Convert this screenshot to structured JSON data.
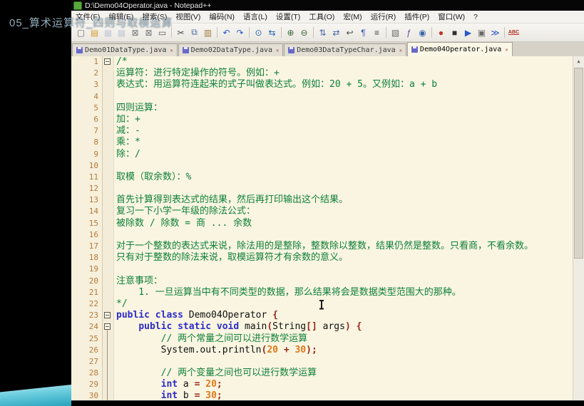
{
  "overlay": {
    "video_title": "05_算术运算符_四则与取模运算"
  },
  "window": {
    "title": "D:\\Demo04Operator.java - Notepad++"
  },
  "menu": {
    "items": [
      {
        "name": "file",
        "label": "文件(F)"
      },
      {
        "name": "edit",
        "label": "编辑(E)"
      },
      {
        "name": "search",
        "label": "搜索(S)"
      },
      {
        "name": "view",
        "label": "视图(V)"
      },
      {
        "name": "encoding",
        "label": "编码(N)"
      },
      {
        "name": "language",
        "label": "语言(L)"
      },
      {
        "name": "settings",
        "label": "设置(T)"
      },
      {
        "name": "tools",
        "label": "工具(O)"
      },
      {
        "name": "macro",
        "label": "宏(M)"
      },
      {
        "name": "run",
        "label": "运行(R)"
      },
      {
        "name": "plugins",
        "label": "插件(P)"
      },
      {
        "name": "window",
        "label": "窗口(W)"
      },
      {
        "name": "help",
        "label": "?"
      }
    ]
  },
  "toolbar": {
    "items": [
      {
        "name": "new-file",
        "glyph": "▢",
        "color": "#6a6a6a"
      },
      {
        "name": "open-file",
        "glyph": "▤",
        "color": "#d79b2a"
      },
      {
        "name": "save",
        "glyph": "▦",
        "color": "#8090b8",
        "disabled": true
      },
      {
        "name": "save-all",
        "glyph": "▩",
        "color": "#8090b8",
        "disabled": true
      },
      {
        "name": "close",
        "glyph": "⊠",
        "color": "#7a7a7a"
      },
      {
        "name": "close-all",
        "glyph": "⊠",
        "color": "#7a7a7a"
      },
      {
        "name": "print",
        "glyph": "▭",
        "color": "#5a5a5a"
      },
      {
        "sep": true
      },
      {
        "name": "cut",
        "glyph": "✂",
        "color": "#4a4a4a"
      },
      {
        "name": "copy",
        "glyph": "⧉",
        "color": "#4a6aaa"
      },
      {
        "name": "paste",
        "glyph": "▥",
        "color": "#a07840"
      },
      {
        "sep": true
      },
      {
        "name": "undo",
        "glyph": "↶",
        "color": "#2858c8"
      },
      {
        "name": "redo",
        "glyph": "↷",
        "color": "#2858c8"
      },
      {
        "sep": true
      },
      {
        "name": "find",
        "glyph": "⊙",
        "color": "#2868b0"
      },
      {
        "name": "replace",
        "glyph": "⇆",
        "color": "#2868b0"
      },
      {
        "sep": true
      },
      {
        "name": "zoom-in",
        "glyph": "⊕",
        "color": "#386838"
      },
      {
        "name": "zoom-out",
        "glyph": "⊖",
        "color": "#386838"
      },
      {
        "sep": true
      },
      {
        "name": "sync-vertical-scroll",
        "glyph": "⇅",
        "color": "#4a6aaa"
      },
      {
        "name": "sync-horizontal-scroll",
        "glyph": "⇄",
        "color": "#4a6aaa"
      },
      {
        "name": "word-wrap",
        "glyph": "↩",
        "color": "#4a4a4a"
      },
      {
        "name": "show-all-characters",
        "glyph": "¶",
        "color": "#3858b8"
      },
      {
        "name": "indent-guide",
        "glyph": "≡",
        "color": "#4a4a4a"
      },
      {
        "sep": true
      },
      {
        "name": "document-map",
        "glyph": "▧",
        "color": "#6a6a6a"
      },
      {
        "name": "function-list",
        "glyph": "ƒ",
        "color": "#6a4a9a"
      },
      {
        "name": "monitoring",
        "glyph": "◉",
        "color": "#3868a8"
      },
      {
        "sep": true
      },
      {
        "name": "record-macro",
        "glyph": "●",
        "color": "#c03028"
      },
      {
        "name": "stop-macro",
        "glyph": "■",
        "color": "#303030"
      },
      {
        "name": "play-macro",
        "glyph": "▶",
        "color": "#2858c8"
      },
      {
        "name": "save-macro",
        "glyph": "▣",
        "color": "#6a6a6a"
      },
      {
        "name": "run-macro-multiple",
        "glyph": "≫",
        "color": "#2858c8"
      },
      {
        "sep": true
      },
      {
        "name": "spell-check",
        "glyph": "ABC",
        "color": "#b02820",
        "text": true
      }
    ]
  },
  "tabs": [
    {
      "label": "Demo01DataType.java",
      "active": false
    },
    {
      "label": "Demo02DataType.java",
      "active": false
    },
    {
      "label": "Demo03DataTypeChar.java",
      "active": false
    },
    {
      "label": "Demo04Operator.java",
      "active": true
    }
  ],
  "editor": {
    "lines": [
      {
        "n": 1,
        "fold": true,
        "seg": [
          {
            "t": "/*",
            "c": "com"
          }
        ]
      },
      {
        "n": 2,
        "seg": [
          {
            "t": "运算符：进行特定操作的符号。例如：+",
            "c": "com"
          }
        ]
      },
      {
        "n": 3,
        "seg": [
          {
            "t": "表达式：用运算符连起来的式子叫做表达式。例如：20 + 5。又例如：a + b",
            "c": "com"
          }
        ]
      },
      {
        "n": 4,
        "seg": []
      },
      {
        "n": 5,
        "seg": [
          {
            "t": "四则运算：",
            "c": "com"
          }
        ]
      },
      {
        "n": 6,
        "seg": [
          {
            "t": "加：+",
            "c": "com"
          }
        ]
      },
      {
        "n": 7,
        "seg": [
          {
            "t": "减：-",
            "c": "com"
          }
        ]
      },
      {
        "n": 8,
        "seg": [
          {
            "t": "乘：*",
            "c": "com"
          }
        ]
      },
      {
        "n": 9,
        "seg": [
          {
            "t": "除：/",
            "c": "com"
          }
        ]
      },
      {
        "n": 10,
        "seg": []
      },
      {
        "n": 11,
        "seg": [
          {
            "t": "取模（取余数）：%",
            "c": "com"
          }
        ]
      },
      {
        "n": 12,
        "seg": []
      },
      {
        "n": 13,
        "seg": [
          {
            "t": "首先计算得到表达式的结果，然后再打印输出这个结果。",
            "c": "com"
          }
        ]
      },
      {
        "n": 14,
        "seg": [
          {
            "t": "复习一下小学一年级的除法公式：",
            "c": "com"
          }
        ]
      },
      {
        "n": 15,
        "seg": [
          {
            "t": "被除数 / 除数 = 商 ... 余数",
            "c": "com"
          }
        ]
      },
      {
        "n": 16,
        "seg": []
      },
      {
        "n": 17,
        "seg": [
          {
            "t": "对于一个整数的表达式来说，除法用的是整除，整数除以整数，结果仍然是整数。只看商，不看余数。",
            "c": "com"
          }
        ]
      },
      {
        "n": 18,
        "seg": [
          {
            "t": "只有对于整数的除法来说，取模运算符才有余数的意义。",
            "c": "com"
          }
        ]
      },
      {
        "n": 19,
        "seg": []
      },
      {
        "n": 20,
        "seg": [
          {
            "t": "注意事项：",
            "c": "com"
          }
        ]
      },
      {
        "n": 21,
        "seg": [
          {
            "t": "    1. 一旦运算当中有不同类型的数据，那么结果将会是数据类型范围大的那种。",
            "c": "com"
          }
        ]
      },
      {
        "n": 22,
        "seg": [
          {
            "t": "*/",
            "c": "com"
          }
        ]
      },
      {
        "n": 23,
        "fold": true,
        "seg": [
          {
            "t": "public class ",
            "c": "kw"
          },
          {
            "t": "Demo04Operator ",
            "c": "pln"
          },
          {
            "t": "{",
            "c": "op"
          }
        ]
      },
      {
        "n": 24,
        "fold": true,
        "guideBelow": true,
        "seg": [
          {
            "t": "    ",
            "c": "pln"
          },
          {
            "t": "public static void ",
            "c": "kw"
          },
          {
            "t": "main",
            "c": "pln"
          },
          {
            "t": "(",
            "c": "op"
          },
          {
            "t": "String",
            "c": "pln"
          },
          {
            "t": "[] ",
            "c": "op"
          },
          {
            "t": "args",
            "c": "pln"
          },
          {
            "t": ") {",
            "c": "op"
          }
        ]
      },
      {
        "n": 25,
        "guide": true,
        "seg": [
          {
            "t": "        ",
            "c": "pln"
          },
          {
            "t": "// 两个常量之间可以进行数学运算",
            "c": "com"
          }
        ]
      },
      {
        "n": 26,
        "guide": true,
        "seg": [
          {
            "t": "        ",
            "c": "pln"
          },
          {
            "t": "System.out.println",
            "c": "pln"
          },
          {
            "t": "(",
            "c": "op"
          },
          {
            "t": "20",
            "c": "num"
          },
          {
            "t": " ",
            "c": "pln"
          },
          {
            "t": "+",
            "c": "op"
          },
          {
            "t": " ",
            "c": "pln"
          },
          {
            "t": "30",
            "c": "num"
          },
          {
            "t": ");",
            "c": "op"
          }
        ]
      },
      {
        "n": 27,
        "guide": true,
        "seg": []
      },
      {
        "n": 28,
        "guide": true,
        "seg": [
          {
            "t": "        ",
            "c": "pln"
          },
          {
            "t": "// 两个变量之间也可以进行数学运算",
            "c": "com"
          }
        ]
      },
      {
        "n": 29,
        "guide": true,
        "seg": [
          {
            "t": "        ",
            "c": "pln"
          },
          {
            "t": "int",
            "c": "kw"
          },
          {
            "t": " a ",
            "c": "pln"
          },
          {
            "t": "=",
            "c": "op"
          },
          {
            "t": " ",
            "c": "pln"
          },
          {
            "t": "20",
            "c": "num"
          },
          {
            "t": ";",
            "c": "op"
          }
        ]
      },
      {
        "n": 30,
        "guide": true,
        "seg": [
          {
            "t": "        ",
            "c": "pln"
          },
          {
            "t": "int",
            "c": "kw"
          },
          {
            "t": " b ",
            "c": "pln"
          },
          {
            "t": "=",
            "c": "op"
          },
          {
            "t": " ",
            "c": "pln"
          },
          {
            "t": "30",
            "c": "num"
          },
          {
            "t": ";",
            "c": "op"
          }
        ]
      }
    ]
  },
  "scrollbar": {
    "up_glyph": "▲"
  },
  "colors": {
    "comment": "#0e8038",
    "keyword": "#2b2bc8",
    "number": "#e07818",
    "operator": "#98281e",
    "line_number": "#b87a38",
    "editor_bg": "#faf5e1",
    "accent_teal": "#27a3bd"
  }
}
